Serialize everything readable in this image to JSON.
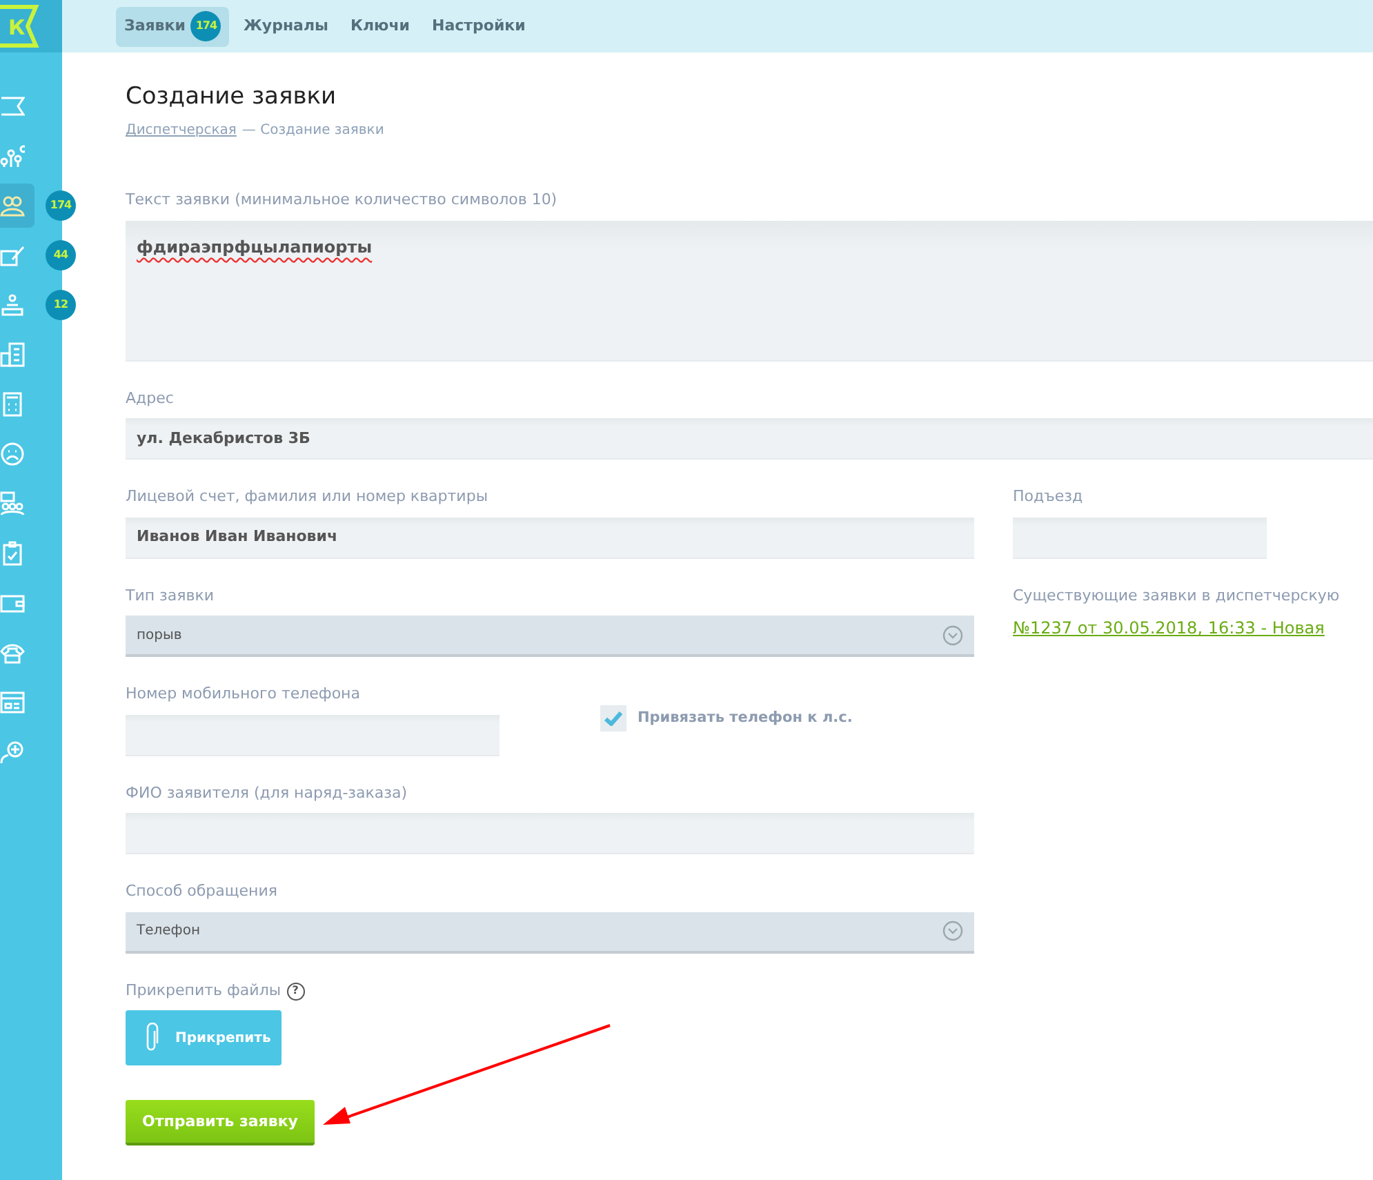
{
  "logo": {
    "letter": "К"
  },
  "top_nav": [
    {
      "label": "Заявки",
      "selected": true,
      "badge": "174"
    },
    {
      "label": "Журналы",
      "selected": false
    },
    {
      "label": "Ключи",
      "selected": false
    },
    {
      "label": "Настройки",
      "selected": false
    }
  ],
  "sidebar": {
    "items": [
      {
        "kind": "flag",
        "selected": false
      },
      {
        "kind": "chart",
        "selected": false
      },
      {
        "kind": "people",
        "selected": true,
        "badge": "174"
      },
      {
        "kind": "edit",
        "selected": false,
        "badge": "44"
      },
      {
        "kind": "reception",
        "selected": false,
        "badge": "12"
      },
      {
        "kind": "building",
        "selected": false
      },
      {
        "kind": "calculator",
        "selected": false
      },
      {
        "kind": "sad",
        "selected": false
      },
      {
        "kind": "group",
        "selected": false
      },
      {
        "kind": "clipboard",
        "selected": false
      },
      {
        "kind": "wallet",
        "selected": false
      },
      {
        "kind": "phone",
        "selected": false
      },
      {
        "kind": "card",
        "selected": false
      },
      {
        "kind": "add",
        "selected": false
      }
    ]
  },
  "page": {
    "title": "Создание заявки",
    "breadcrumb": [
      {
        "label": "Диспетчерская",
        "link": true
      },
      {
        "label": "— Создание заявки",
        "link": false
      }
    ]
  },
  "form": {
    "text": {
      "label": "Текст заявки (минимальное количество символов 10)",
      "value": "фдираэпрфцылапиорты"
    },
    "address": {
      "label": "Адрес",
      "value": "ул. Декабристов 3Б"
    },
    "account": {
      "label": "Лицевой счет, фамилия или номер квартиры",
      "value": "Иванов Иван Иванович"
    },
    "entrance": {
      "label": "Подъезд"
    },
    "type": {
      "label": "Тип заявки",
      "value": "порыв"
    },
    "existing": {
      "label": "Существующие заявки в диспетчерскую",
      "link": "№1237 от 30.05.2018, 16:33 - Новая"
    },
    "phone": {
      "label": "Номер мобильного телефона"
    },
    "bind_phone": {
      "label": "Привязать телефон к л.с.",
      "checked": true
    },
    "applicant": {
      "label": "ФИО заявителя (для наряд-заказа)"
    },
    "channel": {
      "label": "Способ обращения",
      "value": "Телефон"
    },
    "attach": {
      "label": "Прикрепить файлы",
      "help": "?",
      "button": "Прикрепить"
    },
    "submit": "Отправить заявку"
  }
}
